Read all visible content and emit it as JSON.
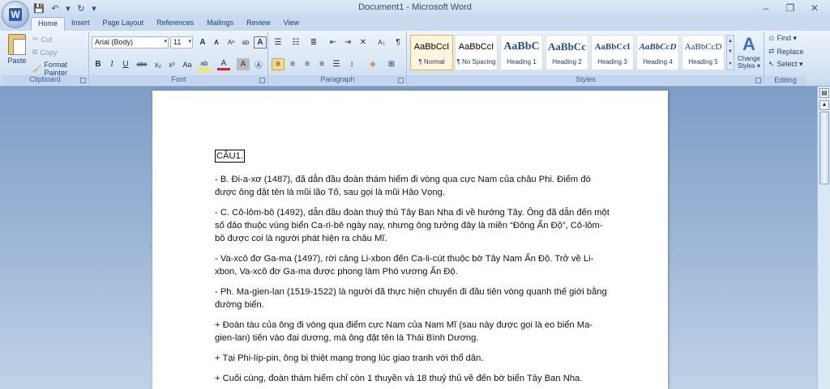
{
  "window": {
    "title": "Document1 - Microsoft Word",
    "minimize": "–",
    "restore": "❐",
    "close": "✕"
  },
  "qat": {
    "save": "💾",
    "undo": "↶",
    "undo_dd": "▾",
    "redo": "↻",
    "customize": "▾"
  },
  "tabs": [
    "Home",
    "Insert",
    "Page Layout",
    "References",
    "Mailings",
    "Review",
    "View"
  ],
  "clipboard": {
    "paste": "Paste",
    "cut": "Cut",
    "copy": "Copy",
    "format_painter": "Format Painter",
    "label": "Clipboard"
  },
  "font": {
    "name": "Arial (Body)",
    "size": "11",
    "grow": "A",
    "shrink": "A",
    "clear": "Aᵃ",
    "abc": "ab",
    "bold": "B",
    "italic": "I",
    "underline": "U",
    "strike": "abc",
    "subscript": "x₂",
    "superscript": "x²",
    "change_case": "Aa",
    "highlight": "ab",
    "color": "A",
    "shade": "A",
    "circle": "Ⓐ",
    "label": "Font"
  },
  "paragraph": {
    "label": "Paragraph",
    "pilcrow": "¶",
    "sort": "A↓"
  },
  "styles": {
    "label": "Styles",
    "items": [
      {
        "sample": "AaBbCcI",
        "name": "¶ Normal"
      },
      {
        "sample": "AaBbCcI",
        "name": "¶ No Spacing"
      },
      {
        "sample": "AaBbC",
        "name": "Heading 1"
      },
      {
        "sample": "AaBbCc",
        "name": "Heading 2"
      },
      {
        "sample": "AaBbCcI",
        "name": "Heading 3"
      },
      {
        "sample": "AaBbCcD",
        "name": "Heading 4"
      },
      {
        "sample": "AaBbCcD",
        "name": "Heading 5"
      }
    ],
    "change_styles": "Change Styles",
    "change_styles_line1": "Change",
    "change_styles_line2": "Styles ▾"
  },
  "editing": {
    "label": "Editing",
    "find": "Find ▾",
    "replace": "Replace",
    "select": "Select ▾"
  },
  "document": {
    "heading": "CÂU1.",
    "paragraphs": [
      "- B. Đi-a-xơ (1487), đã dẫn đầu đoàn thám hiểm đi vòng qua cực Nam của châu Phi. Điểm đó được ông đặt tên là mũi lão Tố, sau gọi là mũi Hảo Vọng.",
      "- C. Cô-lôm-bô (1492), dẫn đầu đoàn thuỷ thủ Tây Ban Nha đi về hướng Tây. Ông đã dẫn đến một số đảo thuộc vùng biển Ca-ri-bê ngày nay, nhưng ông tưởng đây là miền “Đông Ấn Độ”, Cô-lôm-bô được coi là người phát hiện ra châu Mĩ.",
      "- Va-xcô đơ Ga-ma (1497), rời cảng Li-xbon đến Ca-li-cút thuộc bờ Tây Nam Ấn Độ. Trở về Li-xbon, Va-xcô đơ Ga-ma được phong làm Phó vương Ấn Độ.",
      "- Ph. Ma-gien-lan (1519-1522) là người đã thực hiện chuyến đi đầu tiên vòng quanh thế giới bằng đường biển.",
      "+ Đoàn tàu của ông đi vòng qua điểm cực Nam của Nam Mĩ (sau này được gọi là eo biển Ma-gien-lan) tiến vào đại dương, mà ông đặt tên là Thái Bình Dương.",
      "+ Tại Phi-líp-pin, ông bị thiệt mạng trong lúc giao tranh với thổ dân.",
      "+ Cuối cùng, đoàn thám hiểm chỉ còn 1 thuyền và 18 thuỷ thủ về đến bờ biển Tây Ban Nha."
    ]
  },
  "colors": {
    "accent": "#2a5eb4",
    "highlight": "#f8d889"
  }
}
